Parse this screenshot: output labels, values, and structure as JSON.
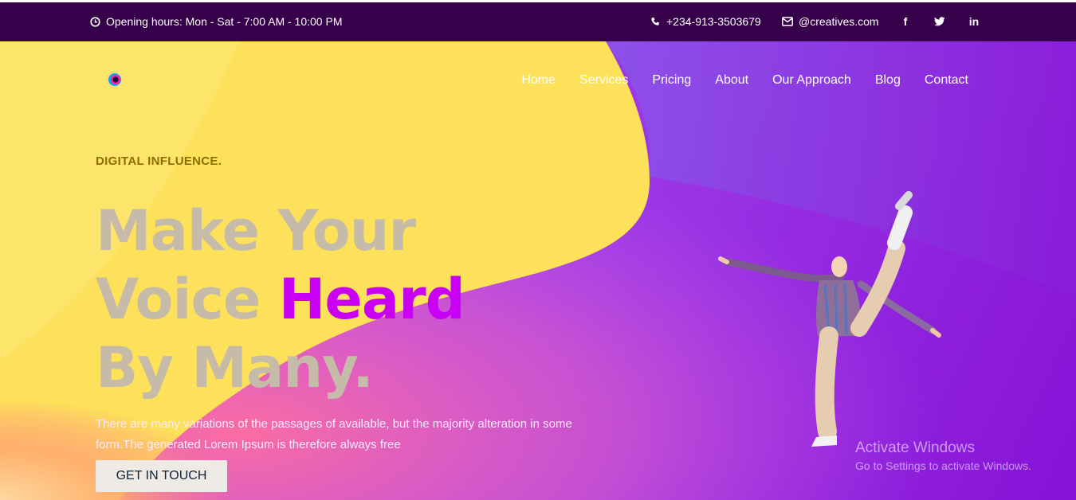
{
  "topbar": {
    "hours": "Opening hours: Mon - Sat - 7:00 AM - 10:00 PM",
    "phone": "+234-913-3503679",
    "email": "@creatives.com",
    "social": [
      "f",
      "t",
      "in"
    ]
  },
  "nav": {
    "items": [
      "Home",
      "Services",
      "Pricing",
      "About",
      "Our Approach",
      "Blog",
      "Contact"
    ]
  },
  "hero": {
    "eyebrow": "DIGITAL INFLUENCE.",
    "line1": "Make Your",
    "line2_a": "Voice ",
    "line2_b": "Heard",
    "line3": "By Many.",
    "description": "There are many variations of the passages of available, but the majority alteration in some form.The generated Lorem Ipsum is therefore always free",
    "cta_label": "GET IN TOUCH"
  },
  "watermark": {
    "title": "Activate Windows",
    "subtitle": "Go to Settings to activate Windows."
  },
  "colors": {
    "topbar_bg": "#36004a",
    "accent": "#c900f5",
    "yellow": "#fde15a",
    "purple": "#8612d6"
  }
}
